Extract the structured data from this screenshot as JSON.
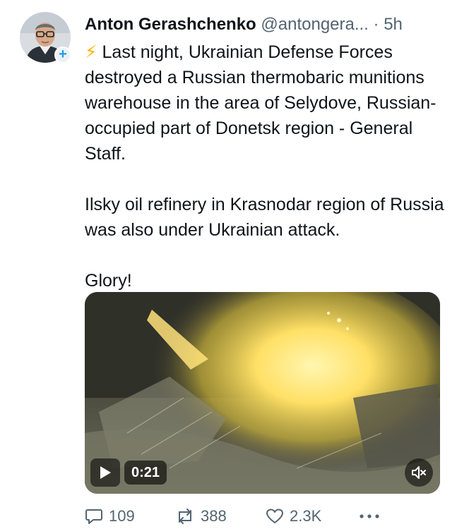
{
  "tweet": {
    "author_name": "Anton Gerashchenko",
    "author_handle": "@antongera...",
    "separator": "·",
    "time": "5h",
    "follow_symbol": "+",
    "bolt_emoji": "⚡",
    "text_line1": "Last night, Ukrainian Defense Forces destroyed a Russian thermobaric munitions warehouse in the area of Selydove, Russian-occupied part of Donetsk region - General Staff.",
    "text_line2": "Ilsky oil refinery in Krasnodar region of Russia was also under Ukrainian attack.",
    "text_line3": "Glory!"
  },
  "video": {
    "duration": "0:21"
  },
  "actions": {
    "replies": "109",
    "retweets": "388",
    "likes": "2.3K"
  },
  "icons": {
    "reply": "reply-icon",
    "retweet": "retweet-icon",
    "like": "heart-icon",
    "more": "more-icon",
    "play": "play-icon",
    "mute": "speaker-icon"
  },
  "colors": {
    "text_primary": "#0f1419",
    "text_secondary": "#536471",
    "accent": "#1d9bf0",
    "bolt": "#f7b500"
  }
}
